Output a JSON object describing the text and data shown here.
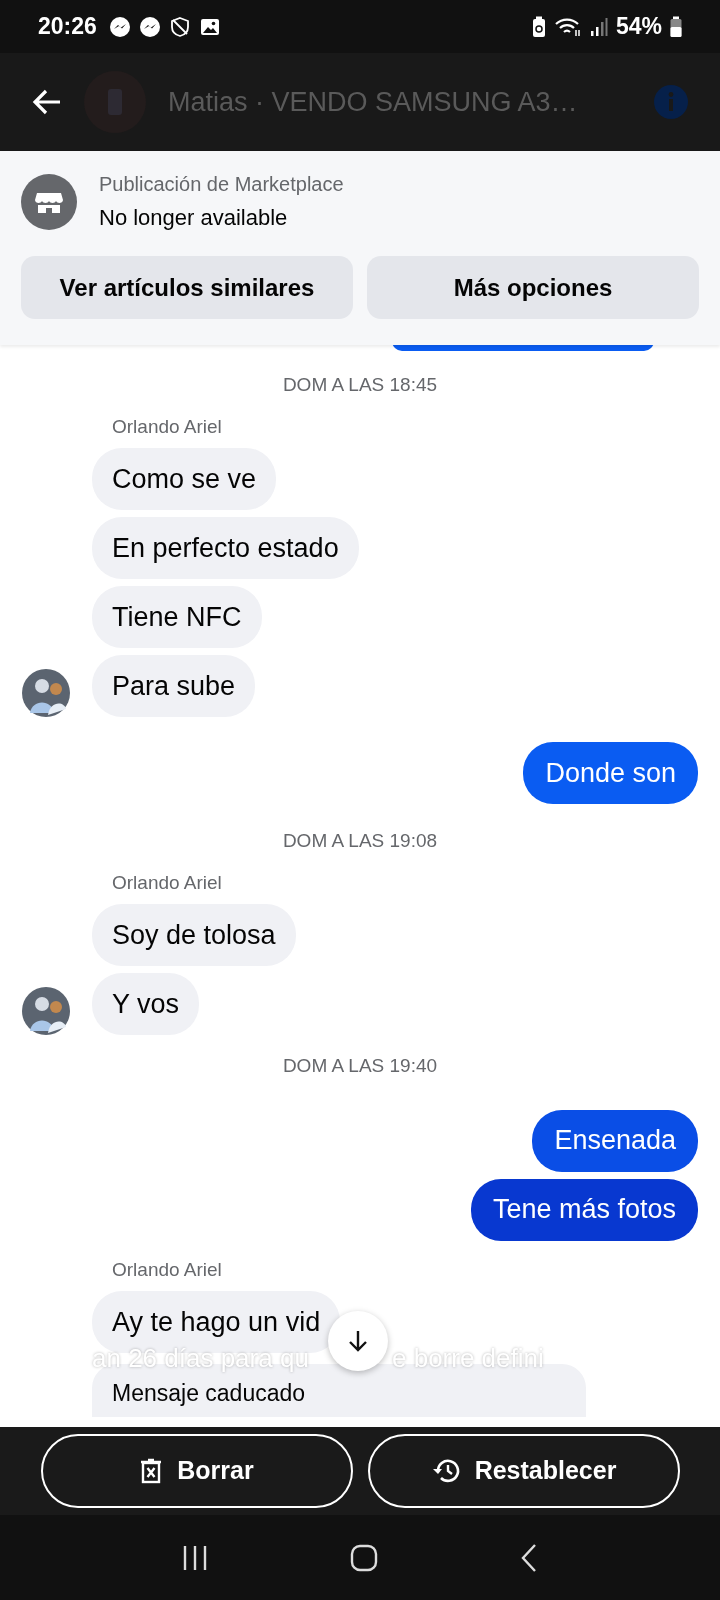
{
  "status_bar": {
    "time": "20:26",
    "battery": "54%"
  },
  "header": {
    "title": "Matias · VENDO SAMSUNG A3…"
  },
  "listing": {
    "label": "Publicación de Marketplace",
    "status": "No longer available",
    "buttons": [
      "Ver artículos similares",
      "Más opciones"
    ]
  },
  "messages": [
    {
      "kind": "time",
      "text": "DOM A LAS 18:45"
    },
    {
      "kind": "sender",
      "text": "Orlando Ariel"
    },
    {
      "kind": "incoming",
      "text": "Como se ve",
      "avatar": false
    },
    {
      "kind": "incoming",
      "text": "En perfecto estado",
      "avatar": false
    },
    {
      "kind": "incoming",
      "text": "Tiene NFC",
      "avatar": false
    },
    {
      "kind": "incoming",
      "text": "Para sube",
      "avatar": true
    },
    {
      "kind": "outgoing",
      "text": "Donde son",
      "color": "#0a5cf2"
    },
    {
      "kind": "time",
      "text": "DOM A LAS 19:08"
    },
    {
      "kind": "sender",
      "text": "Orlando Ariel"
    },
    {
      "kind": "incoming",
      "text": "Soy de tolosa",
      "avatar": false
    },
    {
      "kind": "incoming",
      "text": "Y vos",
      "avatar": true
    },
    {
      "kind": "time",
      "text": "DOM A LAS 19:40"
    },
    {
      "kind": "outgoing",
      "text": "Ensenada",
      "color": "#0a4ee6"
    },
    {
      "kind": "outgoing",
      "text": "Tene más fotos",
      "color": "#0838d0"
    },
    {
      "kind": "sender",
      "text": "Orlando Ariel"
    },
    {
      "kind": "incoming",
      "text": "Ay te hago un vid",
      "avatar": false
    }
  ],
  "expiry_notice": [
    "an 26 días para qu",
    "e borre defini"
  ],
  "expired_message": "Mensaje caducado",
  "action_bar": {
    "buttons": [
      {
        "kind": "delete",
        "label": "Borrar"
      },
      {
        "kind": "restore",
        "label": "Restablecer"
      }
    ]
  }
}
